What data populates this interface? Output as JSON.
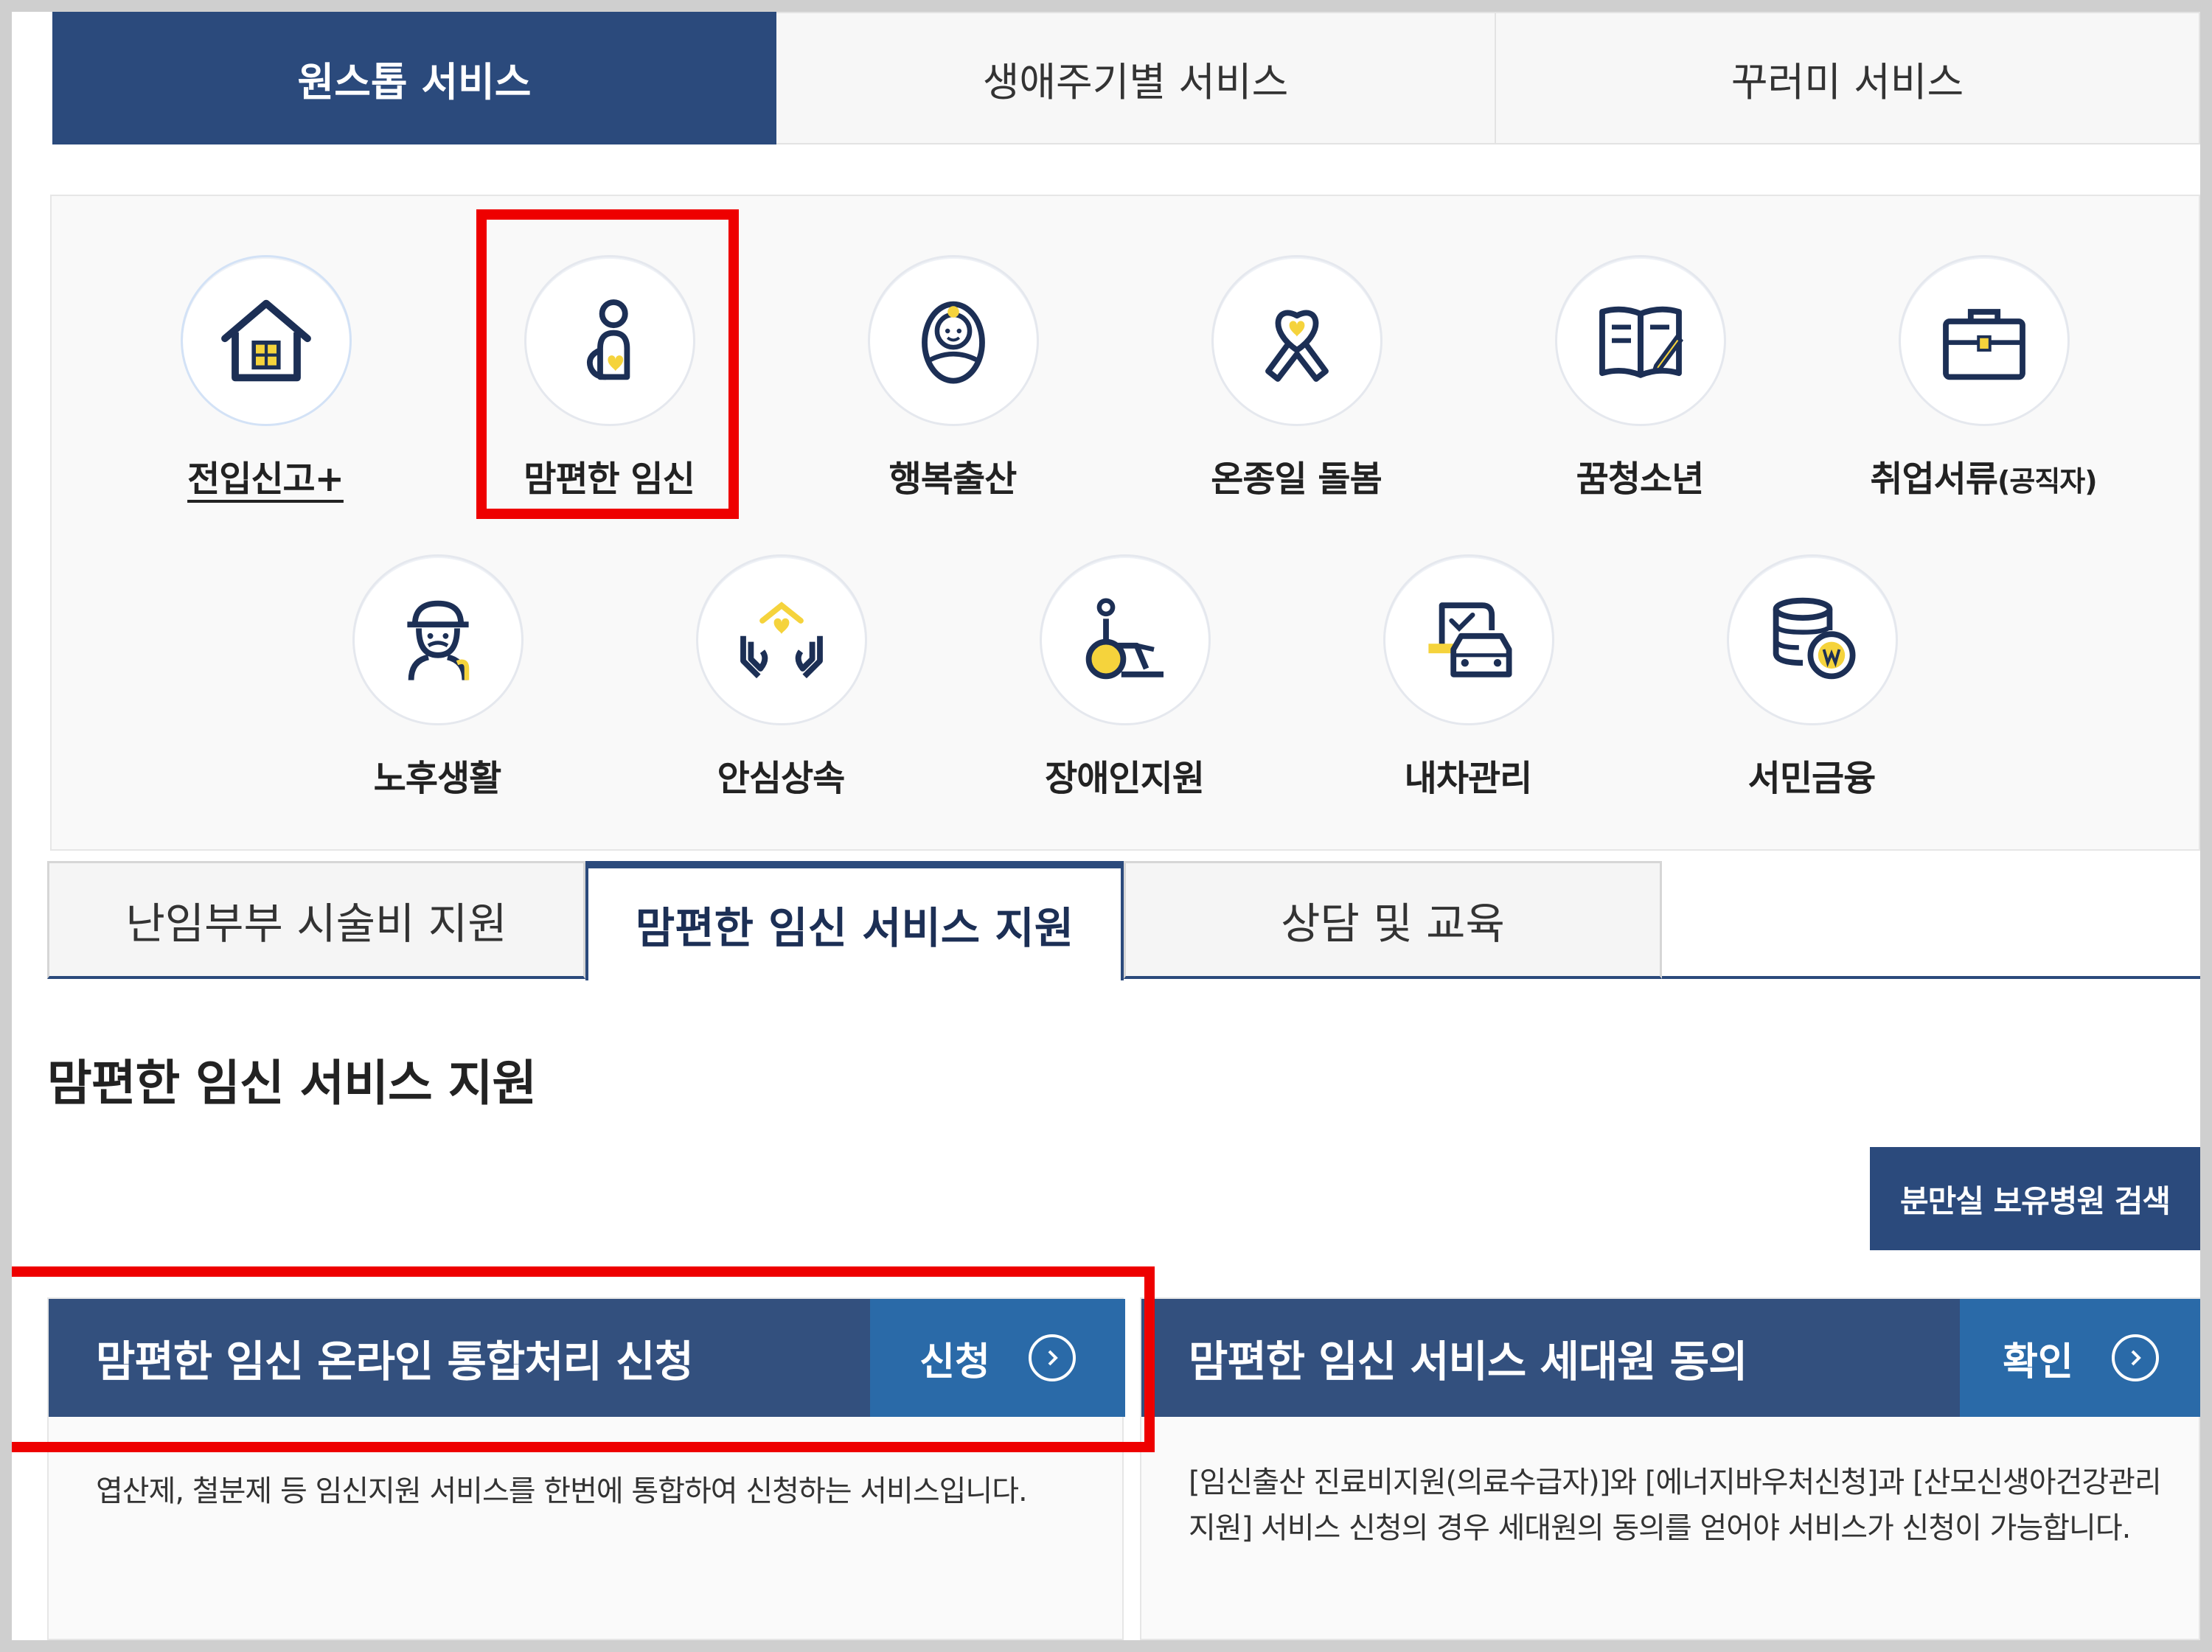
{
  "top_tabs": [
    {
      "label": "원스톱 서비스",
      "active": true
    },
    {
      "label": "생애주기별 서비스",
      "active": false
    },
    {
      "label": "꾸러미 서비스",
      "active": false
    }
  ],
  "services": [
    {
      "label": "전입신고+",
      "icon": "house-icon"
    },
    {
      "label": "맘편한 임신",
      "icon": "pregnant-woman-icon"
    },
    {
      "label": "행복출산",
      "icon": "baby-icon"
    },
    {
      "label": "온종일 돌봄",
      "icon": "ribbon-heart-icon"
    },
    {
      "label": "꿈청소년",
      "icon": "book-pen-icon"
    },
    {
      "label": "취업서류",
      "label_small": "(공직자)",
      "icon": "briefcase-icon"
    },
    {
      "label": "노후생활",
      "icon": "elderly-man-icon"
    },
    {
      "label": "안심상속",
      "icon": "hands-house-icon"
    },
    {
      "label": "장애인지원",
      "icon": "wheelchair-icon"
    },
    {
      "label": "내차관리",
      "icon": "car-document-icon"
    },
    {
      "label": "서민금융",
      "icon": "coins-won-icon"
    }
  ],
  "sub_tabs": [
    {
      "label": "난임부부 시술비 지원",
      "active": false
    },
    {
      "label": "맘편한 임신 서비스 지원",
      "active": true
    },
    {
      "label": "상담 및 교육",
      "active": false
    }
  ],
  "section_title": "맘편한 임신 서비스 지원",
  "search_button": "분만실 보유병원 검색",
  "cards": [
    {
      "title": "맘편한 임신 온라인 통합처리 신청",
      "button": "신청",
      "desc": [
        "엽산제, 철분제 등 임신지원 서비스를 한번에 통합하여 신청하는 서비스입니다."
      ]
    },
    {
      "title": "맘편한 임신 서비스 세대원 동의",
      "button": "확인",
      "desc": [
        "[임신출산 진료비지원(의료수급자)]와 [에너지바우처신청]과 [산모신생아건강관리",
        "지원] 서비스 신청의 경우 세대원의 동의를 얻어야 서비스가 신청이 가능합니다."
      ]
    }
  ],
  "colors": {
    "navy": "#2b4a7c",
    "card_head": "#33507e",
    "card_button": "#2a6aa8",
    "accent_yellow": "#f5d33c",
    "highlight_red": "#ee0000"
  }
}
